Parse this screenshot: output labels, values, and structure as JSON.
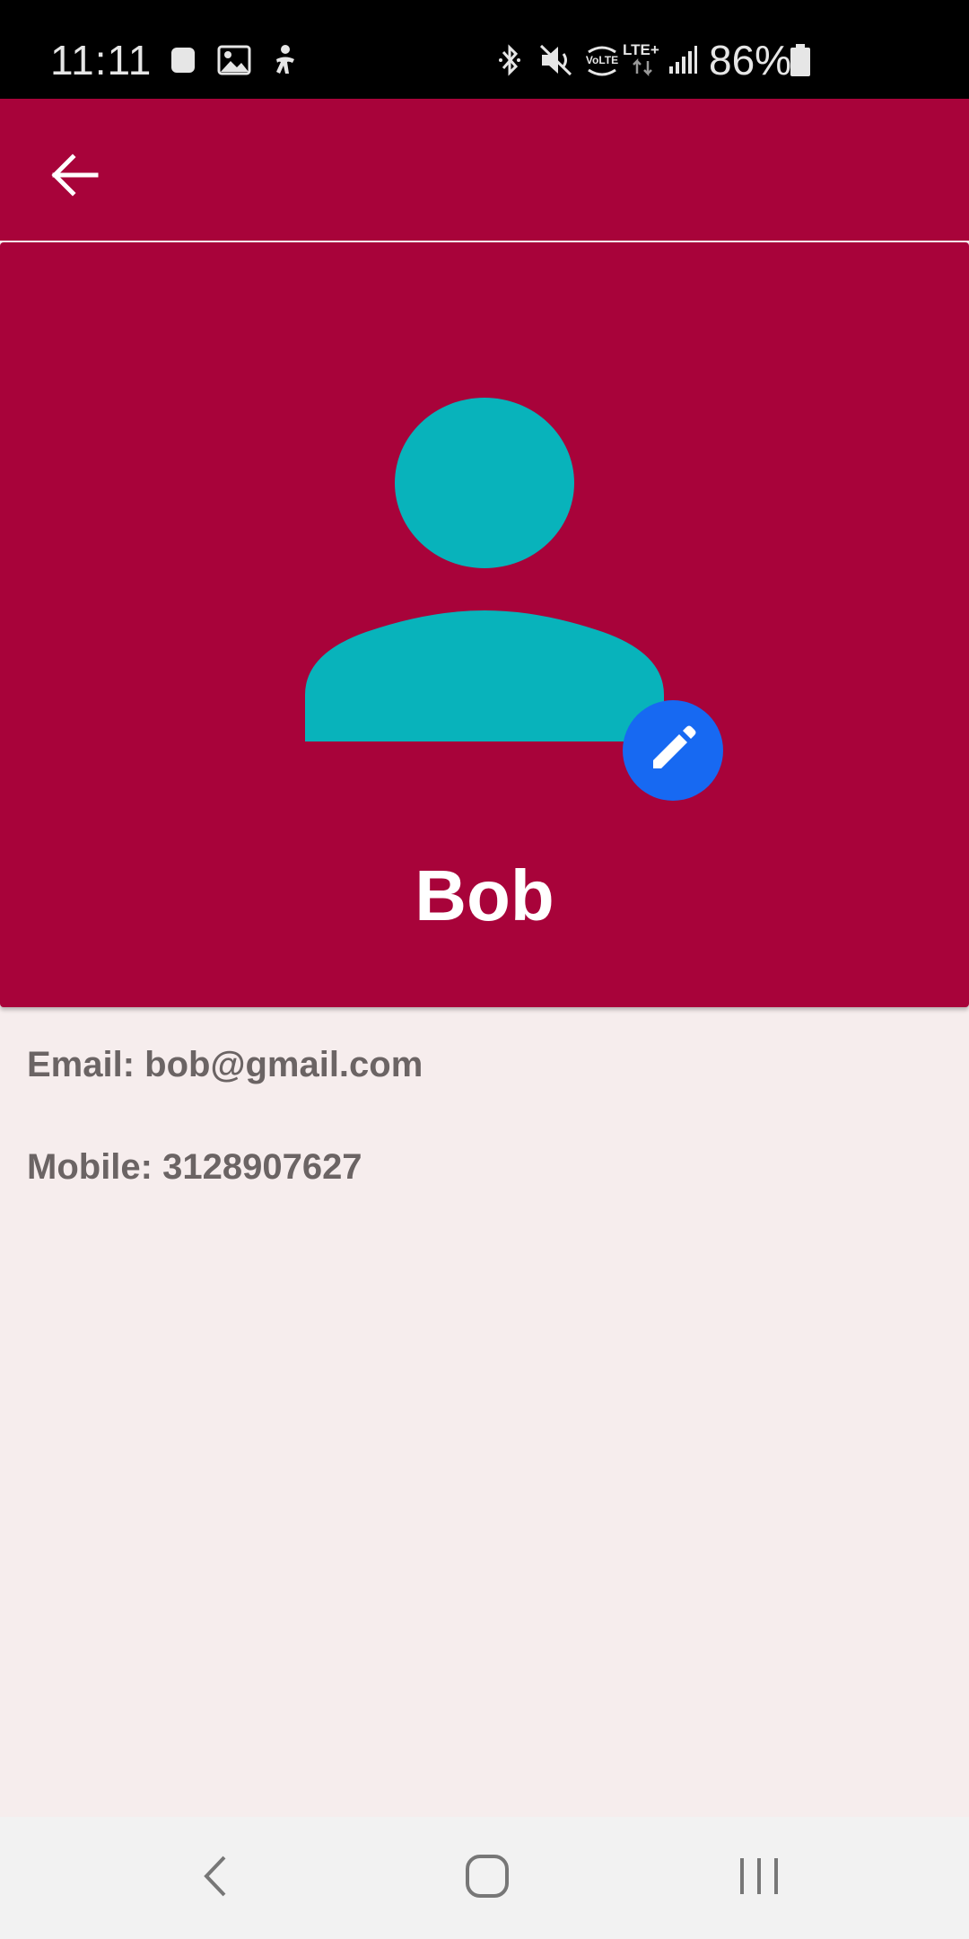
{
  "status_bar": {
    "time": "11:11",
    "battery_percent": "86%",
    "icons": [
      "notification-square-icon",
      "gallery-icon",
      "accessibility-icon",
      "bluetooth-icon",
      "vibrate-mute-icon",
      "volte-icon",
      "lte-plus-icon",
      "signal-icon",
      "battery-icon"
    ]
  },
  "app_bar": {
    "back_icon": "arrow-back-icon"
  },
  "profile": {
    "name": "Bob",
    "avatar_icon": "person-icon",
    "edit_icon": "pencil-icon"
  },
  "details": {
    "email_line": "Email: bob@gmail.com",
    "mobile_line": "Mobile: 3128907627"
  },
  "nav_bar": {
    "back_icon": "nav-back-icon",
    "home_icon": "nav-home-icon",
    "recents_icon": "nav-recents-icon"
  },
  "colors": {
    "primary": "#a8033a",
    "avatar": "#08b3bb",
    "fab": "#1769f2",
    "background": "#f6eded",
    "detail_text": "#6b6464"
  }
}
